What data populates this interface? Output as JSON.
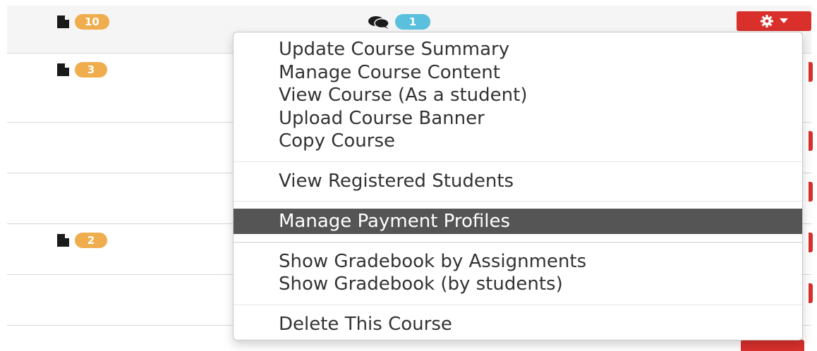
{
  "rows": [
    {
      "files_count": "10",
      "comments_count": "1"
    },
    {
      "files_count": "3"
    },
    {},
    {},
    {
      "files_count": "2"
    },
    {},
    {}
  ],
  "menu": {
    "group1": [
      "Update Course Summary",
      "Manage Course Content",
      "View Course (As a student)",
      "Upload Course Banner",
      "Copy Course"
    ],
    "group2": [
      "View Registered Students"
    ],
    "group3": [
      "Manage Payment Profiles"
    ],
    "group4": [
      "Show Gradebook by Assignments",
      "Show Gradebook (by students)"
    ],
    "group5": [
      "Delete This Course"
    ]
  },
  "icons": {
    "files": "file-icon",
    "comments": "comments-icon",
    "actions": "gear-icon",
    "caret": "caret-down-icon"
  },
  "colors": {
    "badge_orange": "#f0ad4e",
    "badge_blue": "#5bc0de",
    "action_button": "#d9302c",
    "menu_highlight": "#555555"
  }
}
